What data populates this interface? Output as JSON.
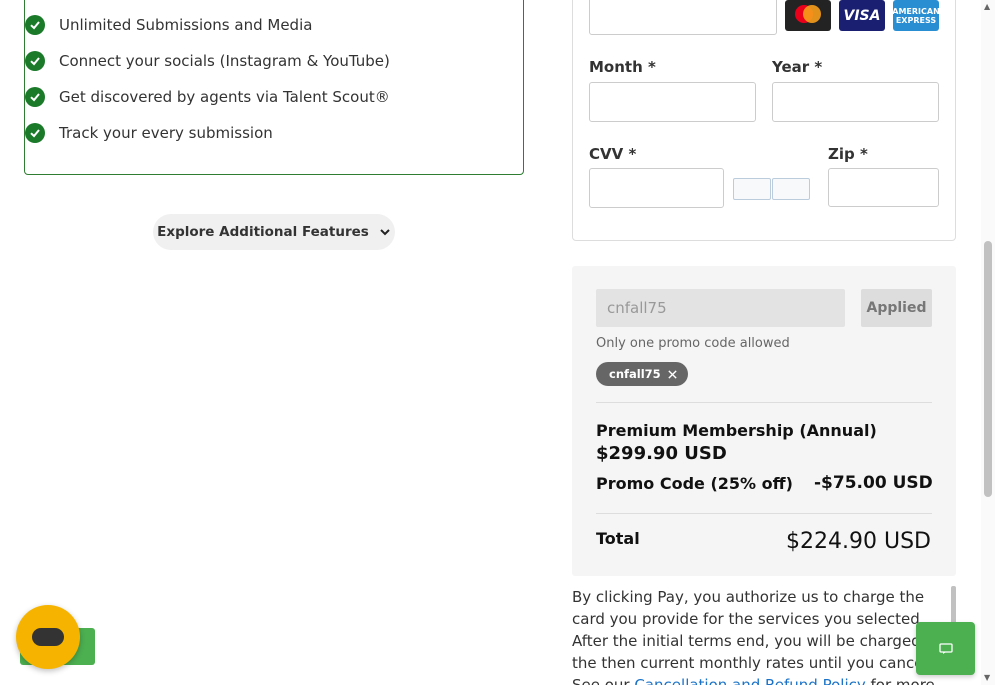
{
  "features": {
    "items": [
      "Unlimited Submissions and Media",
      "Connect your socials (Instagram & YouTube)",
      "Get discovered by agents via Talent Scout®",
      "Track your every submission"
    ],
    "explore_label": "Explore Additional Features"
  },
  "card_form": {
    "month_label": "Month *",
    "year_label": "Year *",
    "cvv_label": "CVV *",
    "zip_label": "Zip *",
    "card_logos": {
      "visa": "VISA",
      "amex_line1": "AMERICAN",
      "amex_line2": "EXPRESS"
    }
  },
  "promo": {
    "input_value": "cnfall75",
    "applied_label": "Applied",
    "note": "Only one promo code allowed",
    "chip_label": "cnfall75"
  },
  "summary": {
    "item_name": "Premium Membership (Annual)",
    "item_price": "$299.90 USD",
    "promo_label": "Promo Code (25% off)",
    "promo_amount": "-$75.00 USD",
    "total_label": "Total",
    "total_amount": "$224.90 USD"
  },
  "disclaimer": {
    "text": "By clicking Pay, you authorize us to charge the card you provide for the services you selected. After the initial terms end, you will be charged at the then current monthly rates until you cancel. See our ",
    "link_text": "Cancellation and Refund Policy",
    "suffix": " for more"
  },
  "colors": {
    "check_green": "#1b7a2a",
    "chat_yellow": "#f6b400",
    "action_green": "#4caf50",
    "link_blue": "#1a73c8"
  }
}
